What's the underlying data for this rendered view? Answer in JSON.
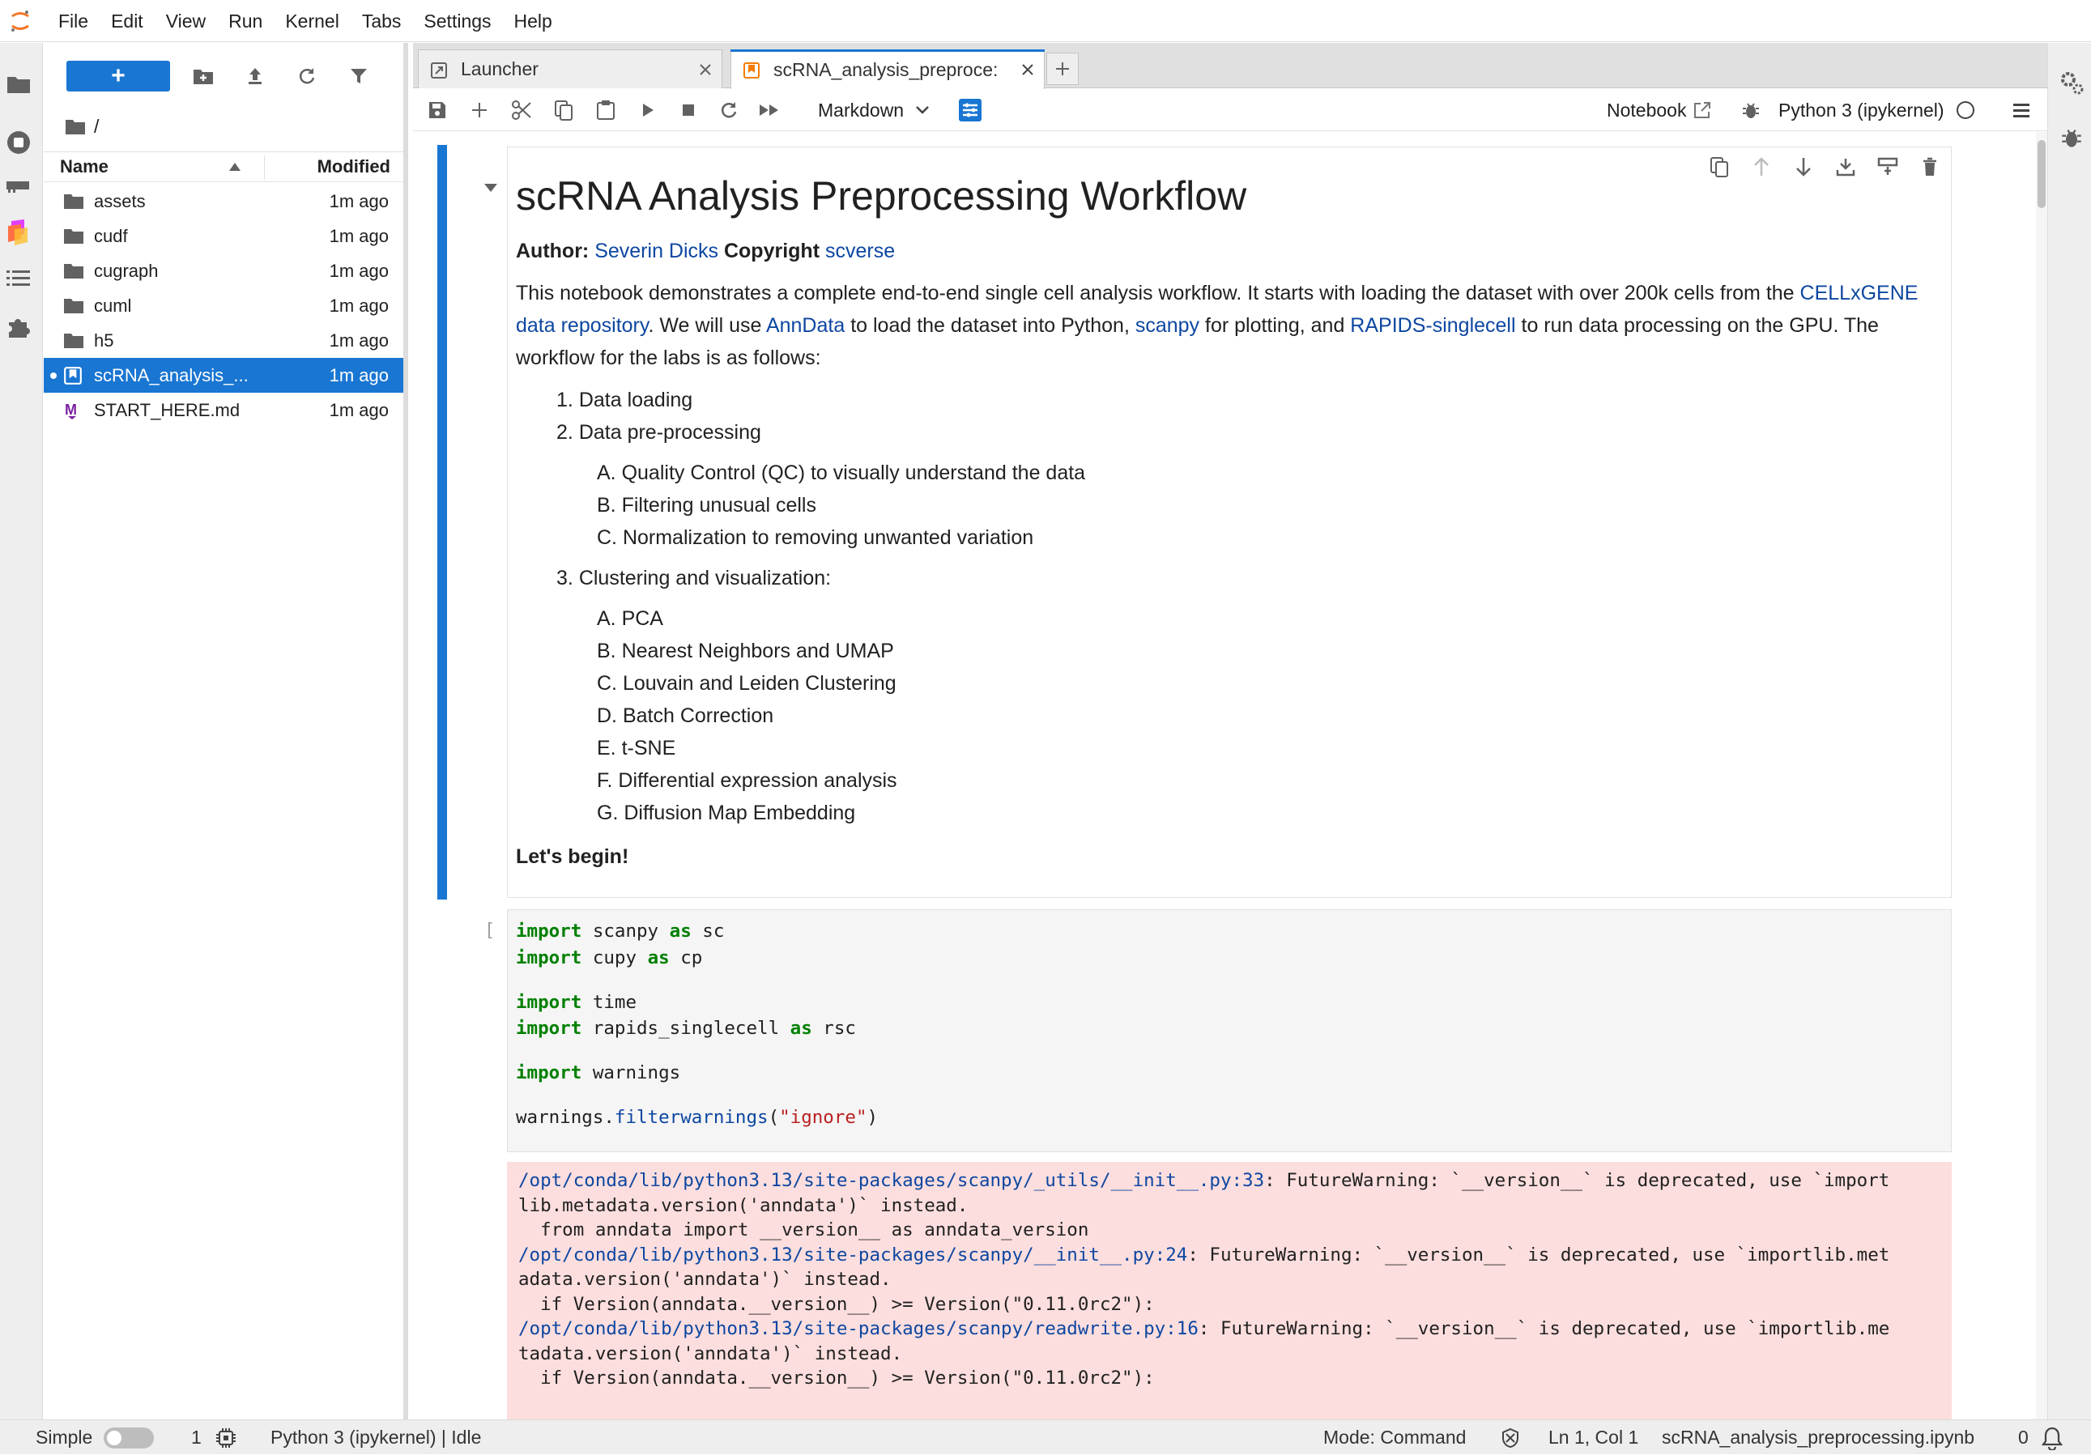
{
  "menubar": {
    "items": [
      "File",
      "Edit",
      "View",
      "Run",
      "Kernel",
      "Tabs",
      "Settings",
      "Help"
    ]
  },
  "filebrowser": {
    "new_label": "+",
    "breadcrumb": "/",
    "col_name": "Name",
    "col_modified": "Modified",
    "files": [
      {
        "name": "assets",
        "modified": "1m ago",
        "type": "folder"
      },
      {
        "name": "cudf",
        "modified": "1m ago",
        "type": "folder"
      },
      {
        "name": "cugraph",
        "modified": "1m ago",
        "type": "folder"
      },
      {
        "name": "cuml",
        "modified": "1m ago",
        "type": "folder"
      },
      {
        "name": "h5",
        "modified": "1m ago",
        "type": "folder"
      },
      {
        "name": "scRNA_analysis_...",
        "modified": "1m ago",
        "type": "notebook",
        "selected": true
      },
      {
        "name": "START_HERE.md",
        "modified": "1m ago",
        "type": "markdown"
      }
    ]
  },
  "tabs": [
    {
      "label": "Launcher"
    },
    {
      "label": "scRNA_analysis_preproce:"
    }
  ],
  "toolbar": {
    "cell_type": "Markdown",
    "notebook_label": "Notebook",
    "kernel_label": "Python 3 (ipykernel)"
  },
  "markdown": {
    "title": "scRNA Analysis Preprocessing Workflow",
    "author_label": "Author:",
    "author_name": "Severin Dicks",
    "copyright_label": "Copyright",
    "copyright_name": "scverse",
    "intro_1": "This notebook demonstrates a complete end-to-end single cell analysis workflow. It starts with loading the dataset with over 200k cells from the ",
    "link_cellxgene": "CELLxGENE data repository",
    "intro_2": ". We will use ",
    "link_anndata": "AnnData",
    "intro_3": " to load the dataset into Python, ",
    "link_scanpy": "scanpy",
    "intro_4": " for plotting, and ",
    "link_rapids": "RAPIDS-singlecell",
    "intro_5": " to run data processing on the GPU. The workflow for the labs is as follows:",
    "steps": [
      {
        "num": "1.",
        "text": "Data loading",
        "sub": []
      },
      {
        "num": "2.",
        "text": "Data pre-processing",
        "sub": [
          {
            "num": "A.",
            "text": "Quality Control (QC) to visually understand the data"
          },
          {
            "num": "B.",
            "text": "Filtering unusual cells"
          },
          {
            "num": "C.",
            "text": "Normalization to removing unwanted variation"
          }
        ]
      },
      {
        "num": "3.",
        "text": "Clustering and visualization:",
        "sub": [
          {
            "num": "A.",
            "text": "PCA"
          },
          {
            "num": "B.",
            "text": "Nearest Neighbors and UMAP"
          },
          {
            "num": "C.",
            "text": "Louvain and Leiden Clustering"
          },
          {
            "num": "D.",
            "text": "Batch Correction"
          },
          {
            "num": "E.",
            "text": "t-SNE"
          },
          {
            "num": "F.",
            "text": "Differential expression analysis"
          },
          {
            "num": "G.",
            "text": "Diffusion Map Embedding"
          }
        ]
      }
    ],
    "closing": "Let's begin!"
  },
  "code_cell": {
    "prompt": "[ ]:",
    "lines": [
      [
        {
          "t": "import",
          "c": "kw"
        },
        {
          "t": " scanpy ",
          "c": ""
        },
        {
          "t": "as",
          "c": "kw"
        },
        {
          "t": " sc",
          "c": ""
        }
      ],
      [
        {
          "t": "import",
          "c": "kw"
        },
        {
          "t": " cupy ",
          "c": ""
        },
        {
          "t": "as",
          "c": "kw"
        },
        {
          "t": " cp",
          "c": ""
        }
      ],
      [],
      [
        {
          "t": "import",
          "c": "kw"
        },
        {
          "t": " time",
          "c": ""
        }
      ],
      [
        {
          "t": "import",
          "c": "kw"
        },
        {
          "t": " rapids_singlecell ",
          "c": ""
        },
        {
          "t": "as",
          "c": "kw"
        },
        {
          "t": " rsc",
          "c": ""
        }
      ],
      [],
      [
        {
          "t": "import",
          "c": "kw"
        },
        {
          "t": " warnings",
          "c": ""
        }
      ],
      [],
      [
        {
          "t": "warnings.",
          "c": ""
        },
        {
          "t": "filterwarnings",
          "c": "fn"
        },
        {
          "t": "(",
          "c": ""
        },
        {
          "t": "\"ignore\"",
          "c": "str"
        },
        {
          "t": ")",
          "c": ""
        }
      ]
    ]
  },
  "output": {
    "lines": [
      [
        {
          "t": "/opt/conda/lib/python3.13/site-packages/scanpy/_utils/__init__.py:33",
          "c": "path"
        },
        {
          "t": ": FutureWarning: `__version__` is deprecated, use `import",
          "c": ""
        }
      ],
      [
        {
          "t": "lib.metadata.version('anndata')` instead.",
          "c": ""
        }
      ],
      [
        {
          "t": "  from anndata import __version__ as anndata_version",
          "c": ""
        }
      ],
      [
        {
          "t": "/opt/conda/lib/python3.13/site-packages/scanpy/__init__.py:24",
          "c": "path"
        },
        {
          "t": ": FutureWarning: `__version__` is deprecated, use `importlib.met",
          "c": ""
        }
      ],
      [
        {
          "t": "adata.version('anndata')` instead.",
          "c": ""
        }
      ],
      [
        {
          "t": "  if Version(anndata.__version__) >= Version(\"0.11.0rc2\"):",
          "c": ""
        }
      ],
      [
        {
          "t": "/opt/conda/lib/python3.13/site-packages/scanpy/readwrite.py:16",
          "c": "path"
        },
        {
          "t": ": FutureWarning: `__version__` is deprecated, use `importlib.me",
          "c": ""
        }
      ],
      [
        {
          "t": "tadata.version('anndata')` instead.",
          "c": ""
        }
      ],
      [
        {
          "t": "  if Version(anndata.__version__) >= Version(\"0.11.0rc2\"):",
          "c": ""
        }
      ]
    ]
  },
  "statusbar": {
    "mode_simple": "Simple",
    "terminals": "1",
    "kernel_status": "Python 3 (ipykernel) | Idle",
    "mode": "Mode: Command",
    "cursor": "Ln 1, Col 1",
    "filename": "scRNA_analysis_preprocessing.ipynb",
    "notifications": "0"
  },
  "colors": {
    "accent": "#1976d2",
    "link": "#0d47a1",
    "error_bg": "#fddede",
    "keyword": "#008000",
    "string": "#ba2121"
  }
}
